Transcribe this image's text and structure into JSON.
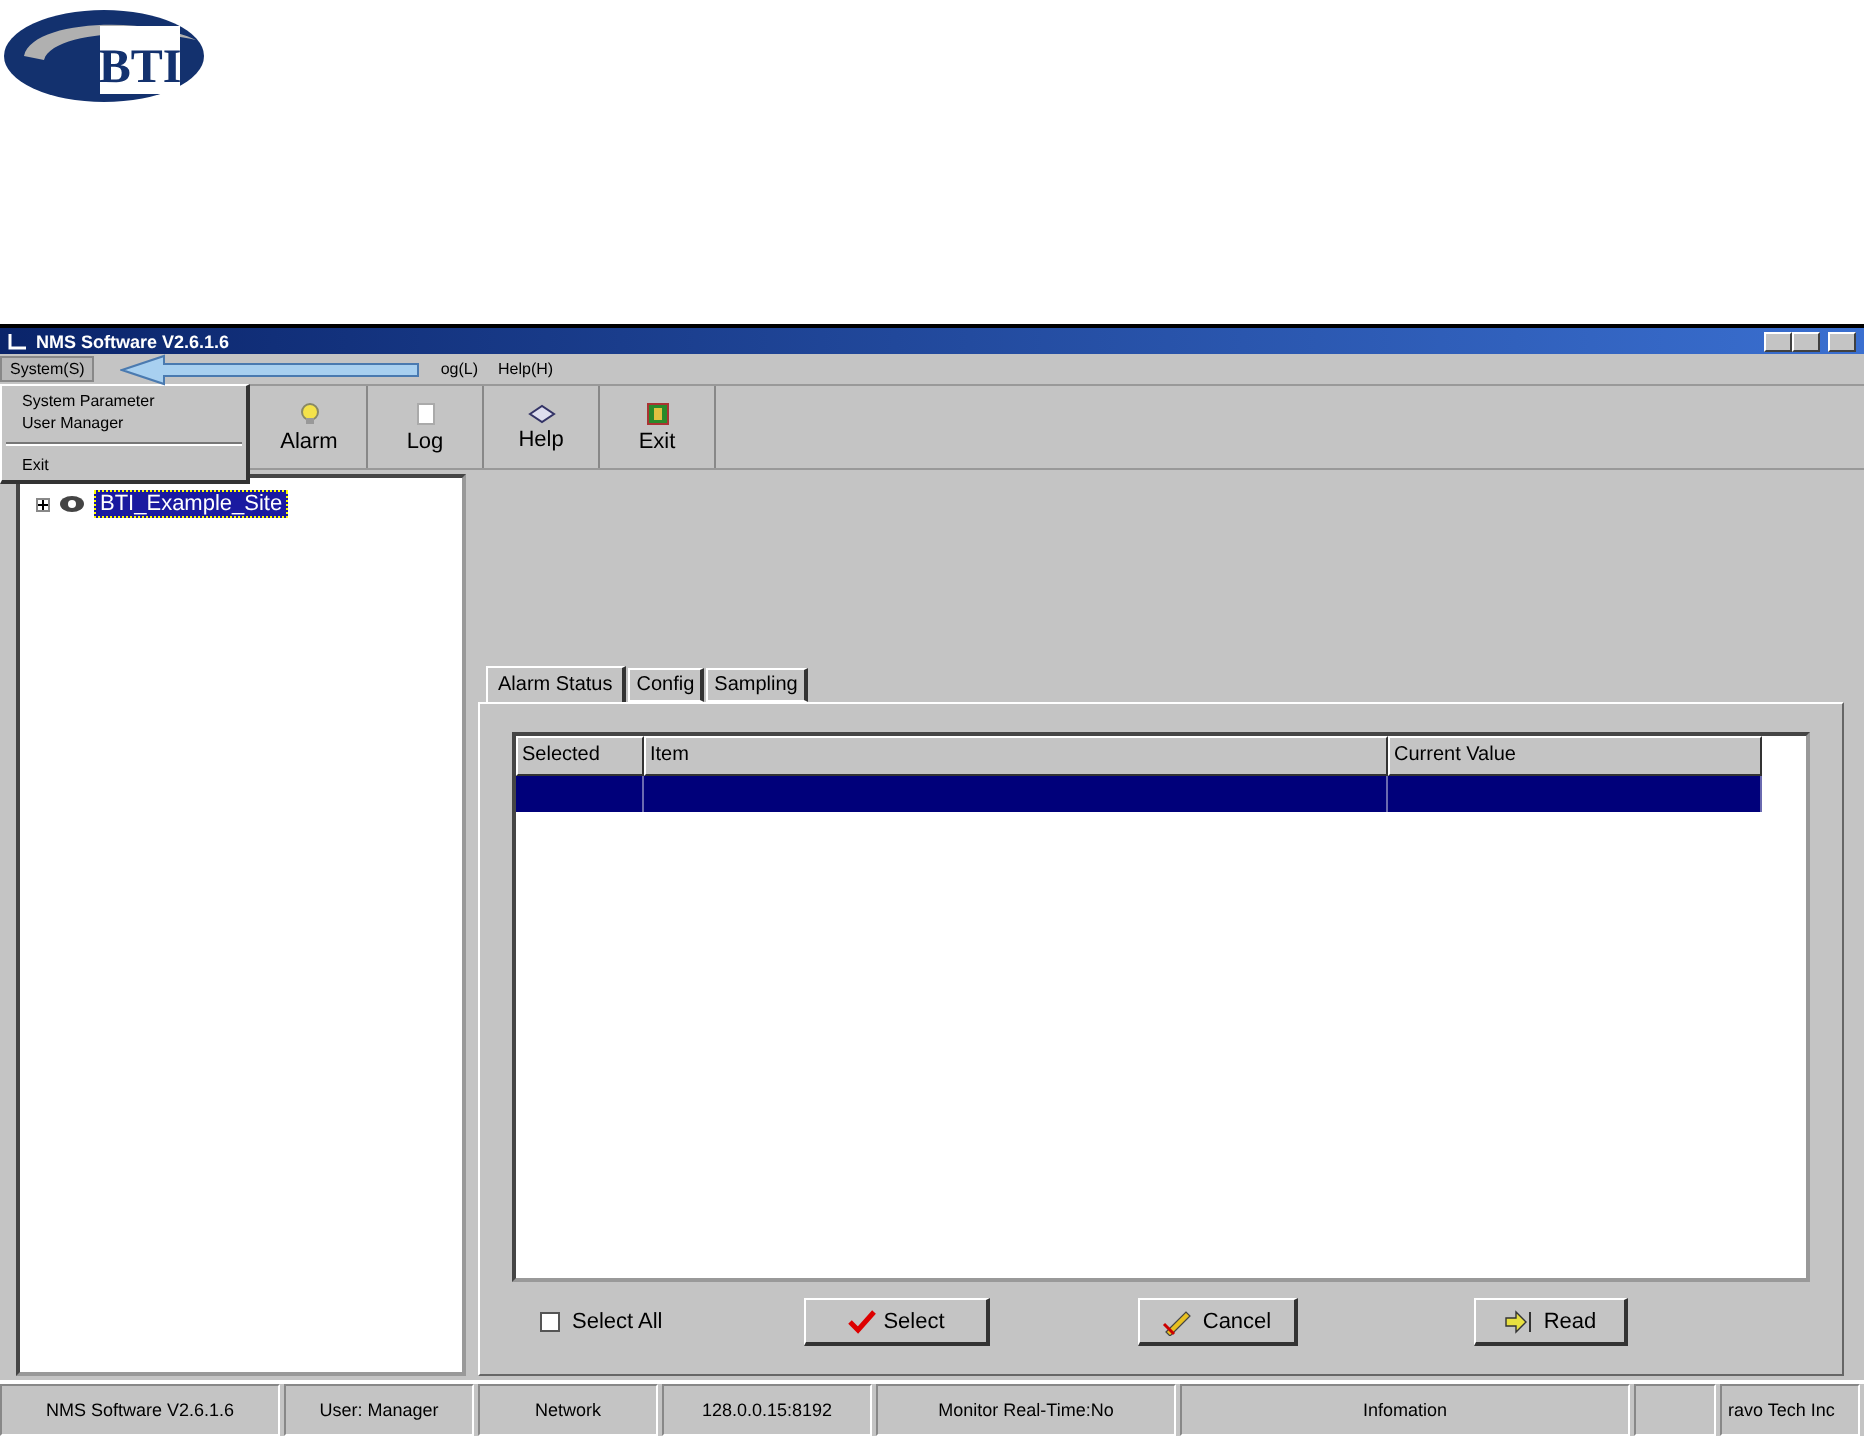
{
  "logo": {
    "text": "BTI"
  },
  "window": {
    "title": "NMS Software V2.6.1.6"
  },
  "menu_bar": [
    {
      "label": "System(S)",
      "selected": true
    },
    {
      "label": "og(L)",
      "selected": false
    },
    {
      "label": "Help(H)",
      "selected": false
    }
  ],
  "dropdown": [
    {
      "kind": "item",
      "label": "System Parameter"
    },
    {
      "kind": "item",
      "label": "User Manager"
    },
    {
      "kind": "separator"
    },
    {
      "kind": "item",
      "label": "Exit"
    }
  ],
  "toolbar": [
    {
      "kind": "alarm",
      "label": "Alarm"
    },
    {
      "kind": "log",
      "label": "Log"
    },
    {
      "kind": "help",
      "label": "Help"
    },
    {
      "kind": "exit",
      "label": "Exit"
    }
  ],
  "tree": [
    {
      "label": "BTI_Example_Site",
      "selected": true,
      "expanded": false
    }
  ],
  "tabs": [
    {
      "label": "Alarm Status",
      "selected": true
    },
    {
      "label": "Config",
      "selected": false
    },
    {
      "label": "Sampling",
      "selected": false
    }
  ],
  "table": {
    "columns": [
      "Selected",
      "Item",
      "Current Value"
    ],
    "rows": [
      {
        "selected": true
      }
    ]
  },
  "select_all": {
    "label": "Select All",
    "checked": false
  },
  "buttons": [
    {
      "kind": "select",
      "label": "Select"
    },
    {
      "kind": "cancel",
      "label": "Cancel"
    },
    {
      "kind": "read",
      "label": "Read"
    }
  ],
  "status_bar": [
    "NMS Software V2.6.1.6",
    "User: Manager",
    "Network",
    "128.0.0.15:8192",
    "Monitor Real-Time:No",
    "Infomation",
    "ravo Tech Inc"
  ]
}
